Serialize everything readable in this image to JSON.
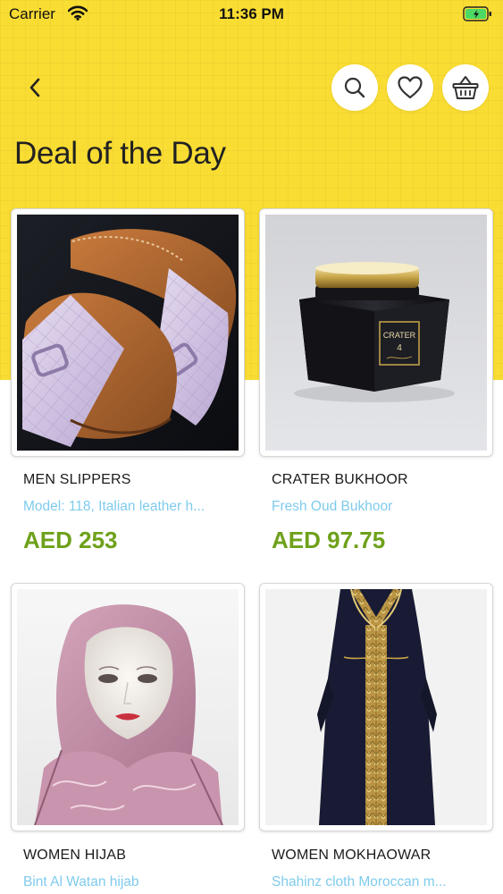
{
  "status_bar": {
    "carrier": "Carrier",
    "time": "11:36 PM"
  },
  "header": {
    "back_icon": "chevron-left-icon",
    "actions": [
      {
        "icon": "search-icon"
      },
      {
        "icon": "heart-icon"
      },
      {
        "icon": "basket-icon"
      }
    ]
  },
  "page": {
    "title": "Deal of the Day"
  },
  "products": [
    {
      "name": "MEN SLIPPERS",
      "description": "Model: 118, Italian leather h...",
      "price": "AED 253",
      "image": "lilac leather slippers"
    },
    {
      "name": "CRATER BUKHOOR",
      "description": "Fresh Oud Bukhoor",
      "price": "AED 97.75",
      "image": "black bukhoor jar with gold lid",
      "label_line1": "CRATER",
      "label_line2": "4"
    },
    {
      "name": "WOMEN HIJAB",
      "description": "Bint Al Watan hijab",
      "price": "",
      "image": "pink hijab on mannequin"
    },
    {
      "name": "WOMEN MOKHAOWAR",
      "description": "Shahinz cloth Moroccan m...",
      "price": "",
      "image": "navy dress with gold embroidery"
    }
  ],
  "colors": {
    "accent": "#fadd33",
    "price": "#6ea11a",
    "description": "#7fcbec",
    "battery": "#4cd964"
  }
}
